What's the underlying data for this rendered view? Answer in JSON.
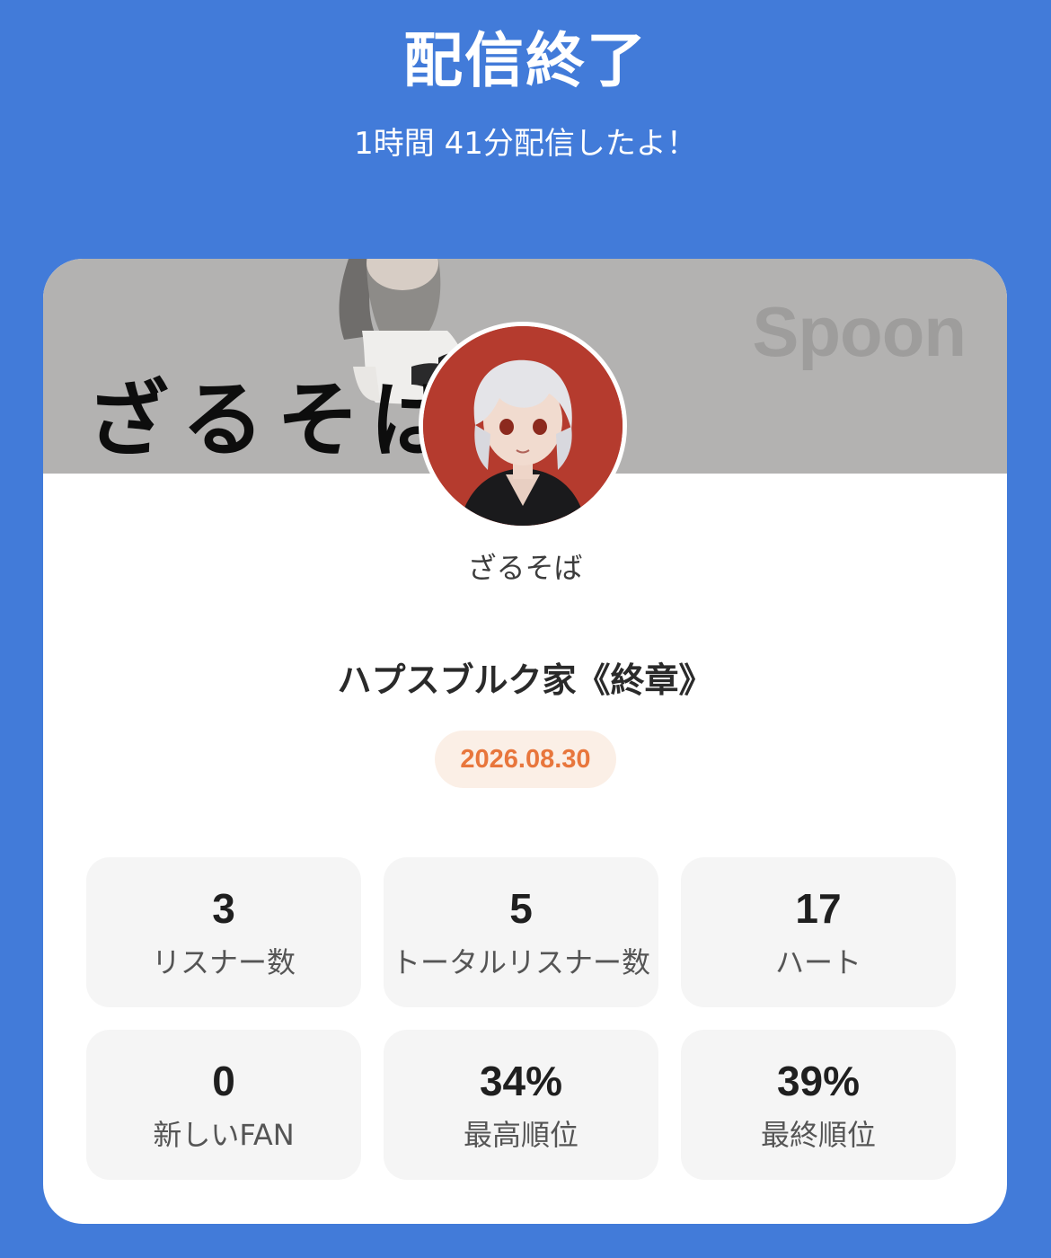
{
  "header": {
    "title": "配信終了",
    "subtitle": "1時間 41分配信したよ！"
  },
  "banner": {
    "text": "ざるそば",
    "logo": "Spoon"
  },
  "profile": {
    "username": "ざるそば"
  },
  "broadcast": {
    "title": "ハプスブルク家《終章》",
    "date": "2026.08.30"
  },
  "stats": [
    {
      "value": "3",
      "label": "リスナー数"
    },
    {
      "value": "5",
      "label": "トータルリスナー数"
    },
    {
      "value": "17",
      "label": "ハート"
    },
    {
      "value": "0",
      "label": "新しいFAN"
    },
    {
      "value": "34%",
      "label": "最高順位"
    },
    {
      "value": "39%",
      "label": "最終順位"
    }
  ],
  "colors": {
    "background": "#427bd9",
    "card": "#ffffff",
    "banner": "#b3b2b1",
    "date_text": "#e8763c",
    "date_bg": "#fbefe6",
    "stat_bg": "#f5f5f5"
  }
}
